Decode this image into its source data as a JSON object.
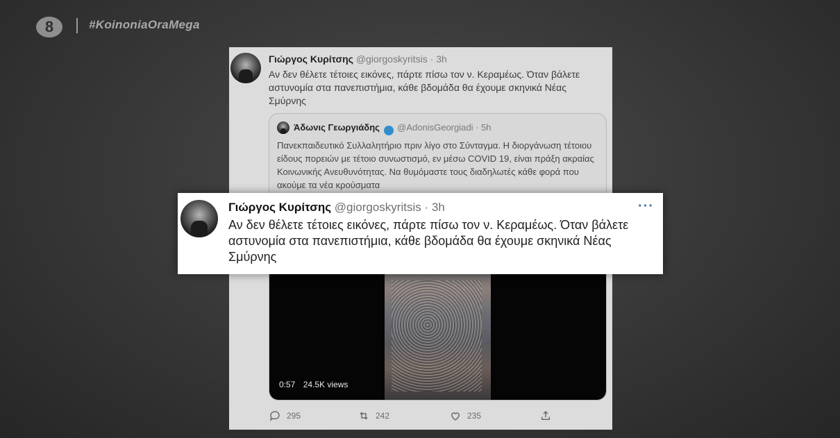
{
  "channel": {
    "logo": "8",
    "hashtag": "#KoinoniaOraMega"
  },
  "tweet": {
    "author": "Γιώργος Κυρίτσης",
    "handle": "@giorgoskyritsis",
    "separator": "·",
    "time": "3h",
    "text": "Αν δεν θέλετε τέτοιες εικόνες, πάρτε πίσω τον ν. Κεραμέως. Όταν βάλετε αστυνομία στα πανεπιστήμια, κάθε βδομάδα θα έχουμε σκηνικά Νέας Σμύρνης"
  },
  "quoted": {
    "author": "Άδωνις Γεωργιάδης",
    "handle": "@AdonisGeorgiadi",
    "separator": "·",
    "time": "5h",
    "text": "Πανεκπαιδευτικό Συλλαλητήριο πριν λίγο στο Σύνταγμα. Η διοργάνωση τέτοιου είδους πορειών με τέτοιο συνωστισμό, εν μέσω COVID 19, είναι πράξη ακραίας Κοινωνικής Ανευθυνότητας. Να θυμόμαστε τους διαδηλωτές κάθε φορά που ακούμε τα νέα κρούσματα",
    "video": {
      "duration": "0:57",
      "views": "24.5K views"
    }
  },
  "actions": {
    "replies": "295",
    "retweets": "242",
    "likes": "235"
  },
  "more_icon": "···"
}
